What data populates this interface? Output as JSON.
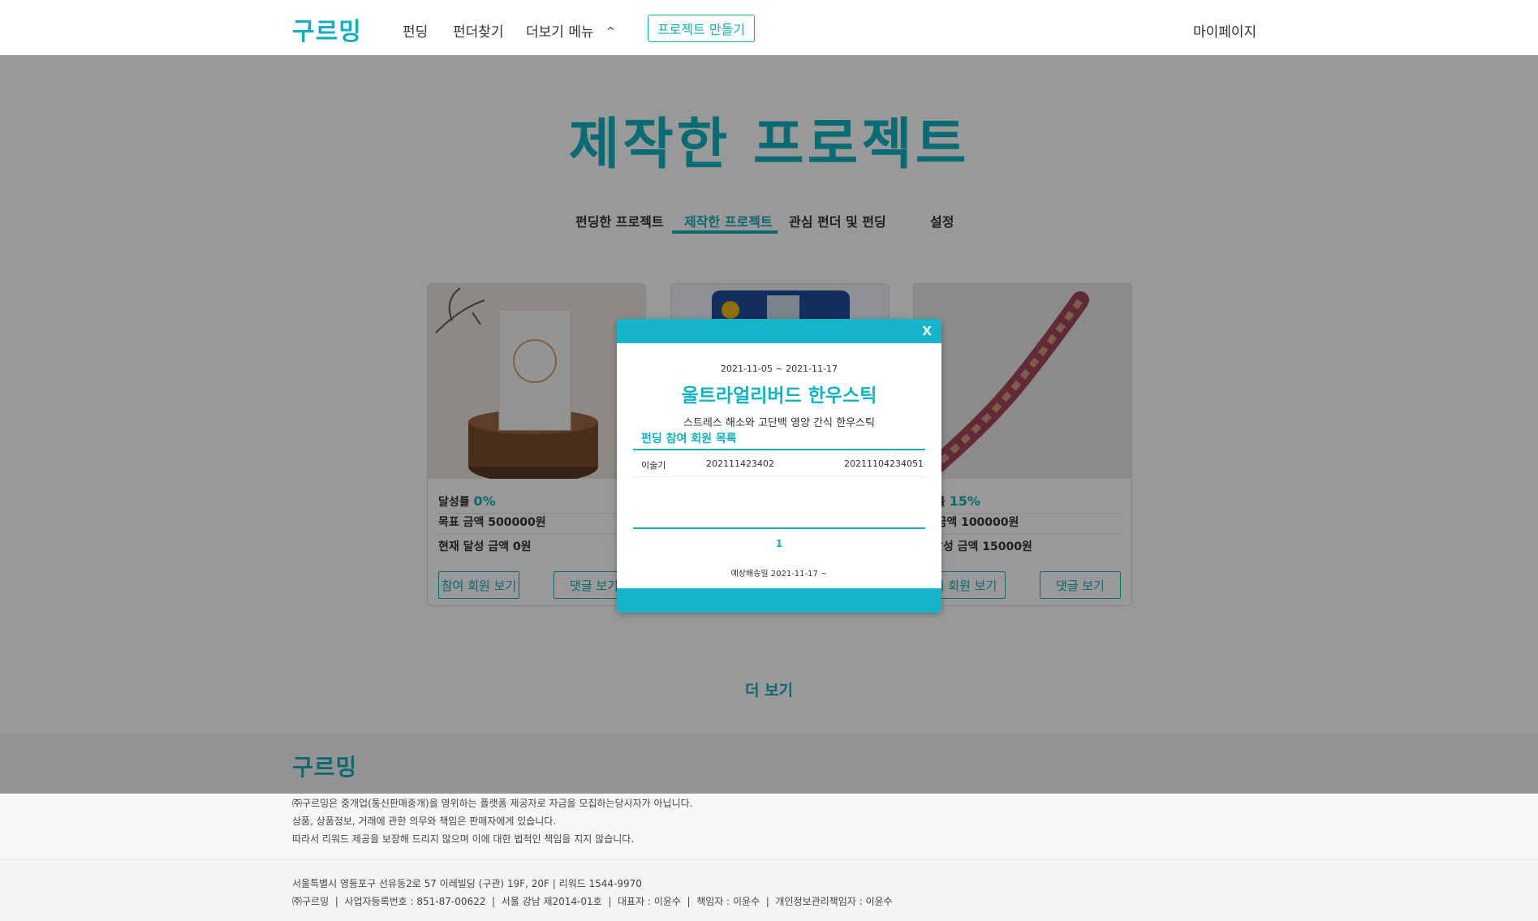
{
  "header": {
    "logo": "구르밍",
    "nav": [
      "펀딩",
      "펀더찾기",
      "더보기 메뉴"
    ],
    "create_button": "프로젝트 만들기",
    "mypage": "마이페이지"
  },
  "page": {
    "title": "제작한 프로젝트",
    "tabs": [
      "펀딩한 프로젝트",
      "제작한 프로젝트",
      "관심 펀더 및 펀딩",
      "설정"
    ],
    "active_tab": "제작한 프로젝트",
    "more_button": "더 보기"
  },
  "cards": [
    {
      "achieve_label": "달성률",
      "achieve_pct": "0%",
      "goal": "목표 금액 500000원",
      "current": "현재 달성 금액 0원",
      "members_button": "참여 회원 보기",
      "comments_button": "댓글 보기"
    },
    {
      "achieve_label": "",
      "achieve_pct": "",
      "goal": "",
      "current": "",
      "members_button": "",
      "comments_button": ""
    },
    {
      "achieve_label": "성률",
      "achieve_pct": "15%",
      "goal": "E 금액 100000원",
      "current": "| 달성 금액 15000원",
      "members_button": "여 회원 보기",
      "comments_button": "댓글 보기"
    }
  ],
  "modal": {
    "close": "X",
    "dates": "2021-11-05 ~ 2021-11-17",
    "title": "울트라얼리버드 한우스틱",
    "subtitle": "스트레스 해소와 고단백 영양 간식 한우스틱",
    "section_title": "펀딩 참여 회원 목록",
    "rows": [
      {
        "name": "이술기",
        "id": "202111423402",
        "date": "20211104234051"
      }
    ],
    "page": "1",
    "shipping": "예상배송일 2021-11-17 ~"
  },
  "footer": {
    "logo": "구르밍",
    "notice": [
      "㈜구르밍은 중개업(통신판매중개)을 영위하는 플랫폼 제공자로 자금을 모집하는당사자가 아닙니다.",
      "상품, 상품정보, 거래에 관한 의무와 책임은 판매자에게 있습니다.",
      "따라서 리워드 제공을 보장해 드리지 않으며 이에 대한 법적인 책임을 지지 않습니다."
    ],
    "address": "서울특별시 영등포구 선유동2로 57 이레빌딩 (구관) 19F, 20F | 리워드 1544-9970",
    "company": "㈜구르밍  |  사업자등록번호 : 851-87-00622  |  서울 강남 제2014-01호  |  대표자 : 이윤수  |  책임자 : 이윤수  |  개인정보관리책임자 : 이윤수"
  },
  "colors": {
    "accent": "#16aebf",
    "modal_bar": "#16b4c8"
  }
}
